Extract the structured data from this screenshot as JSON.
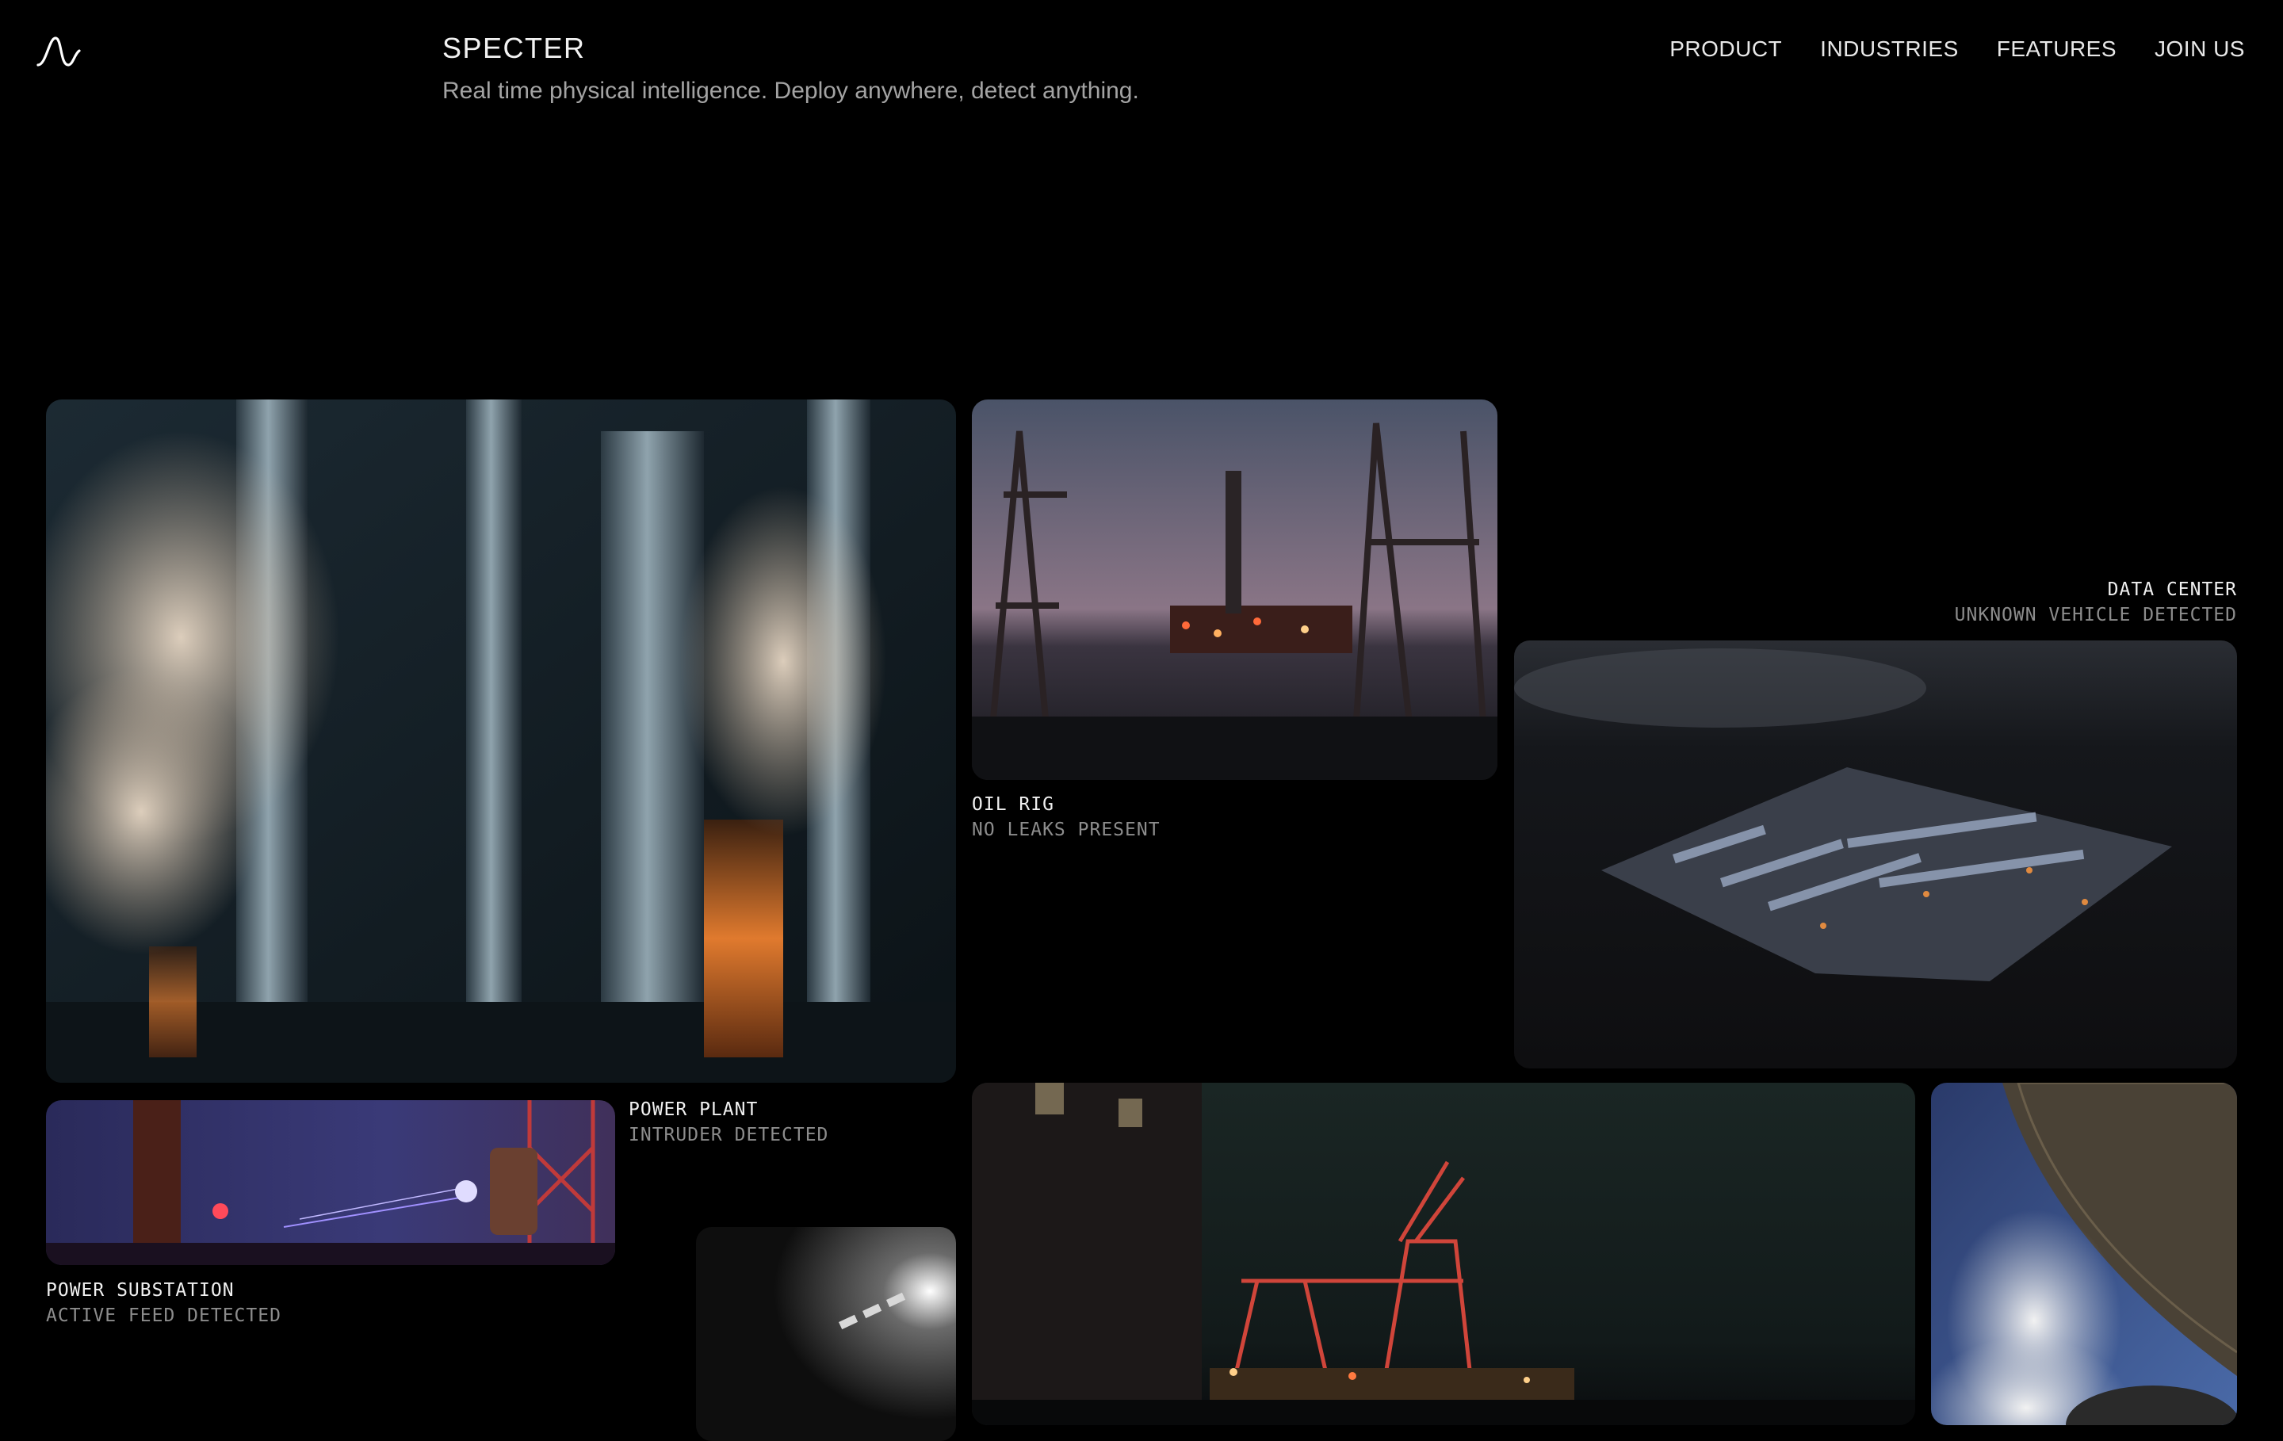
{
  "brand": {
    "name": "SPECTER",
    "tagline": "Real time physical intelligence. Deploy anywhere, detect anything.",
    "logo_icon": "waveform-logo-icon"
  },
  "nav": {
    "items": [
      "PRODUCT",
      "INDUSTRIES",
      "FEATURES",
      "JOIN US"
    ]
  },
  "tiles": {
    "power_plant": {
      "title": "POWER PLANT",
      "status": "INTRUDER DETECTED"
    },
    "oil_rig": {
      "title": "OIL RIG",
      "status": "NO LEAKS PRESENT"
    },
    "data_center": {
      "title": "DATA CENTER",
      "status": "UNKNOWN VEHICLE DETECTED"
    },
    "power_substation": {
      "title": "POWER SUBSTATION",
      "status": "ACTIVE FEED DETECTED"
    }
  },
  "colors": {
    "background": "#000000",
    "text_primary": "#f0f0f0",
    "text_secondary": "#8c8c8c",
    "accent_warm": "#e07a2e"
  }
}
